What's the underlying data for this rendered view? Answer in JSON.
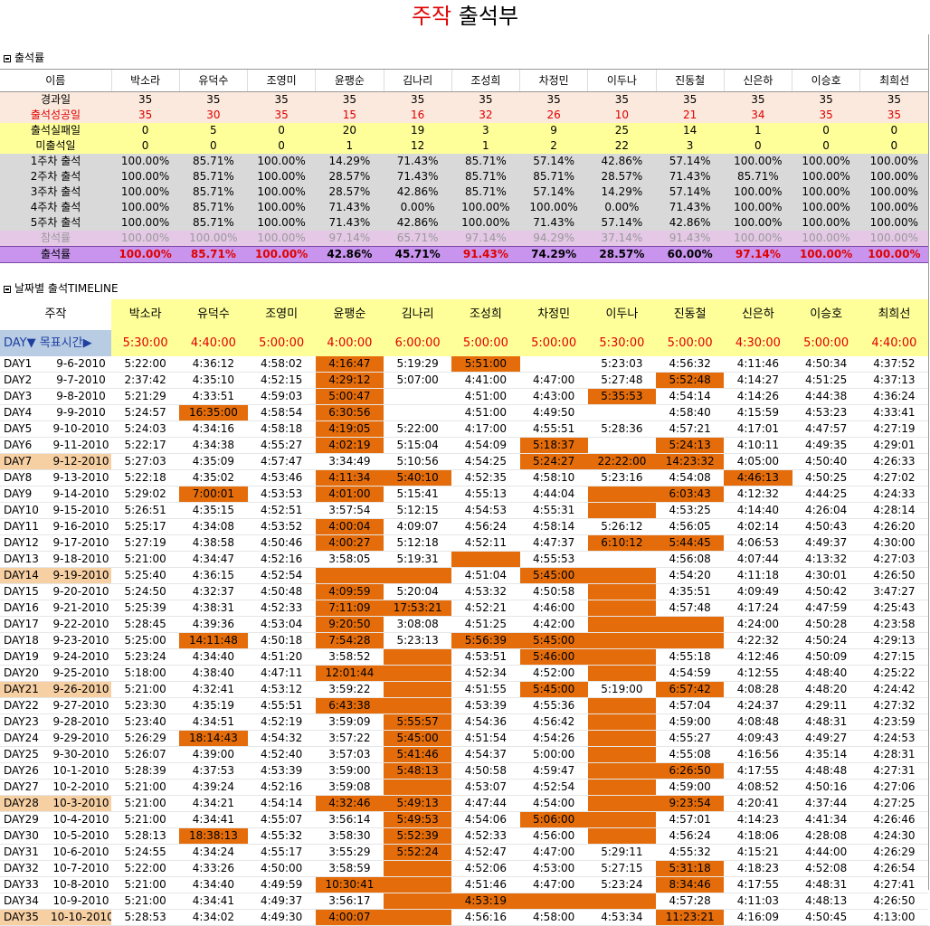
{
  "title": {
    "part1": "주작",
    "part2": "출석부"
  },
  "section1": {
    "label": "출석률"
  },
  "section2": {
    "label": "날짜별 출석TIMELINE"
  },
  "names": [
    "박소라",
    "유덕수",
    "조영미",
    "윤팽순",
    "김나리",
    "조성희",
    "차정민",
    "이두나",
    "진동철",
    "신은하",
    "이승호",
    "최희선"
  ],
  "summary": {
    "header_label": "이름",
    "rows": [
      {
        "key": "elapsed",
        "label": "경과일",
        "values": [
          "35",
          "35",
          "35",
          "35",
          "35",
          "35",
          "35",
          "35",
          "35",
          "35",
          "35",
          "35"
        ]
      },
      {
        "key": "success",
        "label": "출석성공일",
        "values": [
          "35",
          "30",
          "35",
          "15",
          "16",
          "32",
          "26",
          "10",
          "21",
          "34",
          "35",
          "35"
        ]
      },
      {
        "key": "fail",
        "label": "출석실패일",
        "values": [
          "0",
          "5",
          "0",
          "20",
          "19",
          "3",
          "9",
          "25",
          "14",
          "1",
          "0",
          "0"
        ]
      },
      {
        "key": "absent",
        "label": "미출석일",
        "values": [
          "0",
          "0",
          "0",
          "1",
          "12",
          "1",
          "2",
          "22",
          "3",
          "0",
          "0",
          "0"
        ]
      },
      {
        "key": "week",
        "label": "1주차 출석",
        "values": [
          "100.00%",
          "85.71%",
          "100.00%",
          "14.29%",
          "71.43%",
          "85.71%",
          "57.14%",
          "42.86%",
          "57.14%",
          "100.00%",
          "100.00%",
          "100.00%"
        ]
      },
      {
        "key": "week",
        "label": "2주차 출석",
        "values": [
          "100.00%",
          "85.71%",
          "100.00%",
          "28.57%",
          "71.43%",
          "85.71%",
          "85.71%",
          "28.57%",
          "71.43%",
          "85.71%",
          "100.00%",
          "100.00%"
        ]
      },
      {
        "key": "week",
        "label": "3주차 출석",
        "values": [
          "100.00%",
          "85.71%",
          "100.00%",
          "28.57%",
          "42.86%",
          "85.71%",
          "57.14%",
          "14.29%",
          "57.14%",
          "100.00%",
          "100.00%",
          "100.00%"
        ]
      },
      {
        "key": "week",
        "label": "4주차 출석",
        "values": [
          "100.00%",
          "85.71%",
          "100.00%",
          "71.43%",
          "0.00%",
          "100.00%",
          "100.00%",
          "0.00%",
          "71.43%",
          "100.00%",
          "100.00%",
          "100.00%"
        ]
      },
      {
        "key": "week",
        "label": "5주차 출석",
        "values": [
          "100.00%",
          "85.71%",
          "100.00%",
          "71.43%",
          "42.86%",
          "100.00%",
          "71.43%",
          "57.14%",
          "42.86%",
          "100.00%",
          "100.00%",
          "100.00%"
        ]
      },
      {
        "key": "part",
        "label": "참석률",
        "values": [
          "100.00%",
          "100.00%",
          "100.00%",
          "97.14%",
          "65.71%",
          "97.14%",
          "94.29%",
          "37.14%",
          "91.43%",
          "100.00%",
          "100.00%",
          "100.00%"
        ]
      },
      {
        "key": "rate",
        "label": "출석률",
        "values": [
          "100.00%",
          "85.71%",
          "100.00%",
          "42.86%",
          "45.71%",
          "91.43%",
          "74.29%",
          "28.57%",
          "60.00%",
          "97.14%",
          "100.00%",
          "100.00%"
        ],
        "red": [
          true,
          true,
          true,
          false,
          false,
          true,
          false,
          false,
          false,
          true,
          true,
          true
        ]
      }
    ]
  },
  "timeline": {
    "header_label": "주작",
    "target_label": "DAY▼  목표시간▶",
    "targets": [
      "5:30:00",
      "4:40:00",
      "5:00:00",
      "4:00:00",
      "6:00:00",
      "5:00:00",
      "5:00:00",
      "5:30:00",
      "5:00:00",
      "4:30:00",
      "5:00:00",
      "4:40:00"
    ],
    "days": [
      {
        "day": "DAY1",
        "date": "9-6-2010",
        "hl": false,
        "t": [
          "5:22:00",
          "4:36:12",
          "4:58:02",
          "4:16:47",
          "5:19:29",
          "5:51:00",
          "",
          "5:23:03",
          "4:56:32",
          "4:11:46",
          "4:50:34",
          "4:37:52"
        ],
        "o": [
          3,
          5
        ]
      },
      {
        "day": "DAY2",
        "date": "9-7-2010",
        "hl": false,
        "t": [
          "2:37:42",
          "4:35:10",
          "4:52:15",
          "4:29:12",
          "5:07:00",
          "4:41:00",
          "4:47:00",
          "5:27:48",
          "5:52:48",
          "4:14:27",
          "4:51:25",
          "4:37:13"
        ],
        "o": [
          3,
          8
        ]
      },
      {
        "day": "DAY3",
        "date": "9-8-2010",
        "hl": false,
        "t": [
          "5:21:29",
          "4:33:51",
          "4:59:03",
          "5:00:47",
          "",
          "4:51:00",
          "4:43:00",
          "5:35:53",
          "4:54:14",
          "4:14:26",
          "4:44:38",
          "4:36:24"
        ],
        "o": [
          3,
          7
        ]
      },
      {
        "day": "DAY4",
        "date": "9-9-2010",
        "hl": false,
        "t": [
          "5:24:57",
          "16:35:00",
          "4:58:54",
          "6:30:56",
          "",
          "4:51:00",
          "4:49:50",
          "",
          "4:58:40",
          "4:15:59",
          "4:53:23",
          "4:33:41"
        ],
        "o": [
          1,
          3
        ]
      },
      {
        "day": "DAY5",
        "date": "9-10-2010",
        "hl": false,
        "t": [
          "5:24:03",
          "4:34:16",
          "4:58:18",
          "4:19:05",
          "5:22:00",
          "4:17:00",
          "4:55:51",
          "5:28:36",
          "4:57:21",
          "4:17:01",
          "4:47:57",
          "4:27:19"
        ],
        "o": [
          3
        ]
      },
      {
        "day": "DAY6",
        "date": "9-11-2010",
        "hl": false,
        "t": [
          "5:22:17",
          "4:34:38",
          "4:55:27",
          "4:02:19",
          "5:15:04",
          "4:54:09",
          "5:18:37",
          "",
          "5:24:13",
          "4:10:11",
          "4:49:35",
          "4:29:01"
        ],
        "o": [
          3,
          6,
          8
        ]
      },
      {
        "day": "DAY7",
        "date": "9-12-2010",
        "hl": true,
        "t": [
          "5:27:03",
          "4:35:09",
          "4:57:47",
          "3:34:49",
          "5:10:56",
          "4:54:25",
          "5:24:27",
          "22:22:00",
          "14:23:32",
          "4:05:00",
          "4:50:40",
          "4:26:33"
        ],
        "o": [
          6,
          7,
          8
        ]
      },
      {
        "day": "DAY8",
        "date": "9-13-2010",
        "hl": false,
        "t": [
          "5:22:18",
          "4:35:02",
          "4:53:46",
          "4:11:34",
          "5:40:10",
          "4:52:35",
          "4:58:10",
          "5:23:16",
          "4:54:08",
          "4:46:13",
          "4:50:25",
          "4:27:02"
        ],
        "o": [
          3,
          4,
          9
        ]
      },
      {
        "day": "DAY9",
        "date": "9-14-2010",
        "hl": false,
        "t": [
          "5:29:02",
          "7:00:01",
          "4:53:53",
          "4:01:00",
          "5:15:41",
          "4:55:13",
          "4:44:04",
          "",
          "6:03:43",
          "4:12:32",
          "4:44:25",
          "4:24:33"
        ],
        "o": [
          1,
          3,
          7,
          8
        ]
      },
      {
        "day": "DAY10",
        "date": "9-15-2010",
        "hl": false,
        "t": [
          "5:26:51",
          "4:35:15",
          "4:52:51",
          "3:57:54",
          "5:12:15",
          "4:54:53",
          "4:55:31",
          "",
          "4:53:25",
          "4:14:40",
          "4:26:04",
          "4:28:14"
        ],
        "o": [
          7
        ]
      },
      {
        "day": "DAY11",
        "date": "9-16-2010",
        "hl": false,
        "t": [
          "5:25:17",
          "4:34:08",
          "4:53:52",
          "4:00:04",
          "4:09:07",
          "4:56:24",
          "4:58:14",
          "5:26:12",
          "4:56:05",
          "4:02:14",
          "4:50:43",
          "4:26:20"
        ],
        "o": [
          3
        ]
      },
      {
        "day": "DAY12",
        "date": "9-17-2010",
        "hl": false,
        "t": [
          "5:27:19",
          "4:38:58",
          "4:50:46",
          "4:00:27",
          "5:12:18",
          "4:52:11",
          "4:47:37",
          "6:10:12",
          "5:44:45",
          "4:06:53",
          "4:49:37",
          "4:30:00"
        ],
        "o": [
          3,
          7,
          8
        ]
      },
      {
        "day": "DAY13",
        "date": "9-18-2010",
        "hl": false,
        "t": [
          "5:21:00",
          "4:34:47",
          "4:52:16",
          "3:58:05",
          "5:19:31",
          "",
          "4:55:53",
          "",
          "4:56:08",
          "4:07:44",
          "4:13:32",
          "4:27:03"
        ],
        "o": [
          5
        ]
      },
      {
        "day": "DAY14",
        "date": "9-19-2010",
        "hl": true,
        "t": [
          "5:25:40",
          "4:36:15",
          "4:52:54",
          "",
          "",
          "4:51:04",
          "5:45:00",
          "",
          "4:54:20",
          "4:11:18",
          "4:30:01",
          "4:26:50"
        ],
        "o": [
          3,
          4,
          6,
          7
        ]
      },
      {
        "day": "DAY15",
        "date": "9-20-2010",
        "hl": false,
        "t": [
          "5:24:50",
          "4:32:37",
          "4:50:48",
          "4:09:59",
          "5:20:04",
          "4:53:32",
          "4:50:58",
          "",
          "4:35:51",
          "4:09:49",
          "4:50:42",
          "3:47:27"
        ],
        "o": [
          3,
          7
        ]
      },
      {
        "day": "DAY16",
        "date": "9-21-2010",
        "hl": false,
        "t": [
          "5:25:39",
          "4:38:31",
          "4:52:33",
          "7:11:09",
          "17:53:21",
          "4:52:21",
          "4:46:00",
          "",
          "4:57:48",
          "4:17:24",
          "4:47:59",
          "4:25:43"
        ],
        "o": [
          3,
          4,
          7
        ]
      },
      {
        "day": "DAY17",
        "date": "9-22-2010",
        "hl": false,
        "t": [
          "5:28:45",
          "4:39:36",
          "4:53:04",
          "9:20:50",
          "3:08:08",
          "4:51:25",
          "4:42:00",
          "",
          "",
          "4:24:00",
          "4:50:28",
          "4:23:58"
        ],
        "o": [
          3,
          7,
          8
        ]
      },
      {
        "day": "DAY18",
        "date": "9-23-2010",
        "hl": false,
        "t": [
          "5:25:00",
          "14:11:48",
          "4:50:18",
          "7:54:28",
          "5:23:13",
          "5:56:39",
          "5:45:00",
          "",
          "",
          "4:22:32",
          "4:50:24",
          "4:29:13"
        ],
        "o": [
          1,
          3,
          5,
          6,
          7,
          8
        ]
      },
      {
        "day": "DAY19",
        "date": "9-24-2010",
        "hl": false,
        "t": [
          "5:23:24",
          "4:34:40",
          "4:51:20",
          "3:58:52",
          "",
          "4:53:51",
          "5:46:00",
          "",
          "4:55:18",
          "4:12:46",
          "4:50:09",
          "4:27:15"
        ],
        "o": [
          4,
          6,
          7
        ]
      },
      {
        "day": "DAY20",
        "date": "9-25-2010",
        "hl": false,
        "t": [
          "5:18:00",
          "4:38:40",
          "4:47:11",
          "12:01:44",
          "",
          "4:52:34",
          "4:52:00",
          "",
          "4:54:59",
          "4:12:55",
          "4:48:40",
          "4:25:22"
        ],
        "o": [
          3,
          4,
          7
        ]
      },
      {
        "day": "DAY21",
        "date": "9-26-2010",
        "hl": true,
        "t": [
          "5:21:00",
          "4:32:41",
          "4:53:12",
          "3:59:22",
          "",
          "4:51:55",
          "5:45:00",
          "5:19:00",
          "6:57:42",
          "4:08:28",
          "4:48:20",
          "4:24:42"
        ],
        "o": [
          4,
          6,
          8
        ]
      },
      {
        "day": "DAY22",
        "date": "9-27-2010",
        "hl": false,
        "t": [
          "5:23:30",
          "4:35:19",
          "4:55:51",
          "6:43:38",
          "",
          "4:53:39",
          "4:55:36",
          "",
          "4:57:04",
          "4:24:37",
          "4:29:11",
          "4:27:32"
        ],
        "o": [
          3,
          4,
          7
        ]
      },
      {
        "day": "DAY23",
        "date": "9-28-2010",
        "hl": false,
        "t": [
          "5:23:40",
          "4:34:51",
          "4:52:19",
          "3:59:09",
          "5:55:57",
          "4:54:36",
          "4:56:42",
          "",
          "4:59:00",
          "4:08:48",
          "4:48:31",
          "4:23:59"
        ],
        "o": [
          4,
          7
        ]
      },
      {
        "day": "DAY24",
        "date": "9-29-2010",
        "hl": false,
        "t": [
          "5:26:29",
          "18:14:43",
          "4:54:32",
          "3:57:22",
          "5:45:00",
          "4:51:54",
          "4:54:26",
          "",
          "4:55:27",
          "4:09:43",
          "4:49:27",
          "4:24:53"
        ],
        "o": [
          1,
          4,
          7
        ]
      },
      {
        "day": "DAY25",
        "date": "9-30-2010",
        "hl": false,
        "t": [
          "5:26:07",
          "4:39:00",
          "4:52:40",
          "3:57:03",
          "5:41:46",
          "4:54:37",
          "5:00:00",
          "",
          "4:55:08",
          "4:16:56",
          "4:35:14",
          "4:28:31"
        ],
        "o": [
          4,
          7
        ]
      },
      {
        "day": "DAY26",
        "date": "10-1-2010",
        "hl": false,
        "t": [
          "5:28:39",
          "4:37:53",
          "4:53:39",
          "3:59:00",
          "5:48:13",
          "4:50:58",
          "4:59:47",
          "",
          "6:26:50",
          "4:17:55",
          "4:48:48",
          "4:27:31"
        ],
        "o": [
          4,
          7,
          8
        ]
      },
      {
        "day": "DAY27",
        "date": "10-2-2010",
        "hl": false,
        "t": [
          "5:21:00",
          "4:39:24",
          "4:52:16",
          "3:59:08",
          "",
          "4:53:07",
          "4:52:54",
          "",
          "4:59:00",
          "4:08:52",
          "4:50:16",
          "4:27:06"
        ],
        "o": [
          4,
          7
        ]
      },
      {
        "day": "DAY28",
        "date": "10-3-2010",
        "hl": true,
        "t": [
          "5:21:00",
          "4:34:21",
          "4:54:14",
          "4:32:46",
          "5:49:13",
          "4:47:44",
          "4:54:00",
          "",
          "9:23:54",
          "4:20:41",
          "4:37:44",
          "4:27:25"
        ],
        "o": [
          3,
          4,
          7,
          8
        ]
      },
      {
        "day": "DAY29",
        "date": "10-4-2010",
        "hl": false,
        "t": [
          "5:21:00",
          "4:34:41",
          "4:55:07",
          "3:56:14",
          "5:49:53",
          "4:54:06",
          "5:06:00",
          "",
          "4:57:01",
          "4:14:23",
          "4:41:34",
          "4:26:46"
        ],
        "o": [
          4,
          6,
          7
        ]
      },
      {
        "day": "DAY30",
        "date": "10-5-2010",
        "hl": false,
        "t": [
          "5:28:13",
          "18:38:13",
          "4:55:32",
          "3:58:30",
          "5:52:39",
          "4:52:33",
          "4:56:00",
          "",
          "4:56:24",
          "4:18:06",
          "4:28:08",
          "4:24:30"
        ],
        "o": [
          1,
          4,
          7
        ]
      },
      {
        "day": "DAY31",
        "date": "10-6-2010",
        "hl": false,
        "t": [
          "5:24:55",
          "4:34:24",
          "4:55:17",
          "3:55:29",
          "5:52:24",
          "4:52:47",
          "4:47:00",
          "5:29:11",
          "4:55:32",
          "4:15:21",
          "4:44:00",
          "4:26:29"
        ],
        "o": [
          4
        ]
      },
      {
        "day": "DAY32",
        "date": "10-7-2010",
        "hl": false,
        "t": [
          "5:22:00",
          "4:33:26",
          "4:50:00",
          "3:58:59",
          "",
          "4:52:06",
          "4:53:00",
          "5:27:15",
          "5:31:18",
          "4:18:23",
          "4:52:08",
          "4:26:54"
        ],
        "o": [
          4,
          8
        ]
      },
      {
        "day": "DAY33",
        "date": "10-8-2010",
        "hl": false,
        "t": [
          "5:21:00",
          "4:34:40",
          "4:49:59",
          "10:30:41",
          "",
          "4:51:46",
          "4:47:00",
          "5:23:24",
          "8:34:46",
          "4:17:55",
          "4:48:31",
          "4:27:41"
        ],
        "o": [
          3,
          4,
          8
        ]
      },
      {
        "day": "DAY34",
        "date": "10-9-2010",
        "hl": false,
        "t": [
          "5:21:00",
          "4:34:41",
          "4:49:37",
          "3:56:17",
          "",
          "4:53:19",
          "",
          "",
          "4:57:28",
          "4:11:03",
          "4:48:13",
          "4:26:50"
        ],
        "o": [
          4,
          5,
          6,
          7
        ]
      },
      {
        "day": "DAY35",
        "date": "10-10-2010",
        "hl": true,
        "t": [
          "5:28:53",
          "4:34:02",
          "4:49:30",
          "4:00:07",
          "",
          "4:56:16",
          "4:58:00",
          "4:53:34",
          "11:23:21",
          "4:16:09",
          "4:50:45",
          "4:13:00"
        ],
        "o": [
          3,
          4,
          8
        ]
      }
    ]
  },
  "colors": {
    "highlight": "#e46c0a",
    "red": "#e00000",
    "yellow": "#ffff99",
    "purple": "#c894ee"
  }
}
